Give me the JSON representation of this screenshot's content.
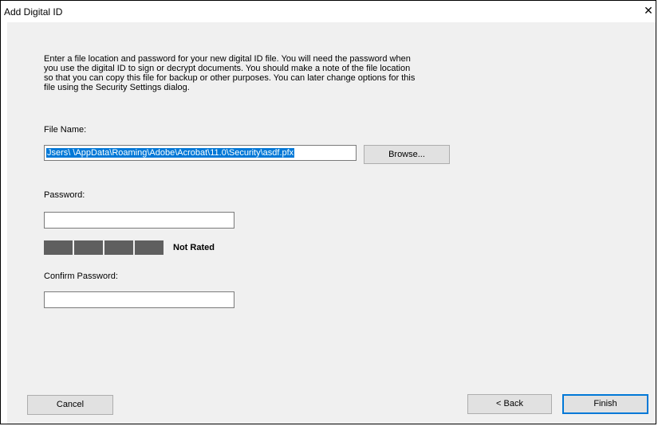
{
  "window": {
    "title": "Add Digital ID"
  },
  "intro_text": "Enter a file location and password for your new digital ID file. You will need the password when\nyou use the digital ID to sign or decrypt documents. You should make a note of the file location\nso that you can copy this file for backup or other purposes. You can later change options for this\nfile using the Security Settings dialog.",
  "file_name": {
    "label": "File Name:",
    "value": "Jsers\\            \\AppData\\Roaming\\Adobe\\Acrobat\\11.0\\Security\\asdf.pfx",
    "browse_label": "Browse..."
  },
  "password": {
    "label": "Password:",
    "value": "",
    "strength_label": "Not Rated"
  },
  "confirm_password": {
    "label": "Confirm Password:",
    "value": ""
  },
  "buttons": {
    "cancel": "Cancel",
    "back": "< Back",
    "finish": "Finish"
  },
  "colors": {
    "selection": "#0078d7",
    "strength_segment": "#5f5f5f",
    "dialog_bg": "#f0f0f0"
  },
  "icons": {
    "close": "close-icon"
  }
}
